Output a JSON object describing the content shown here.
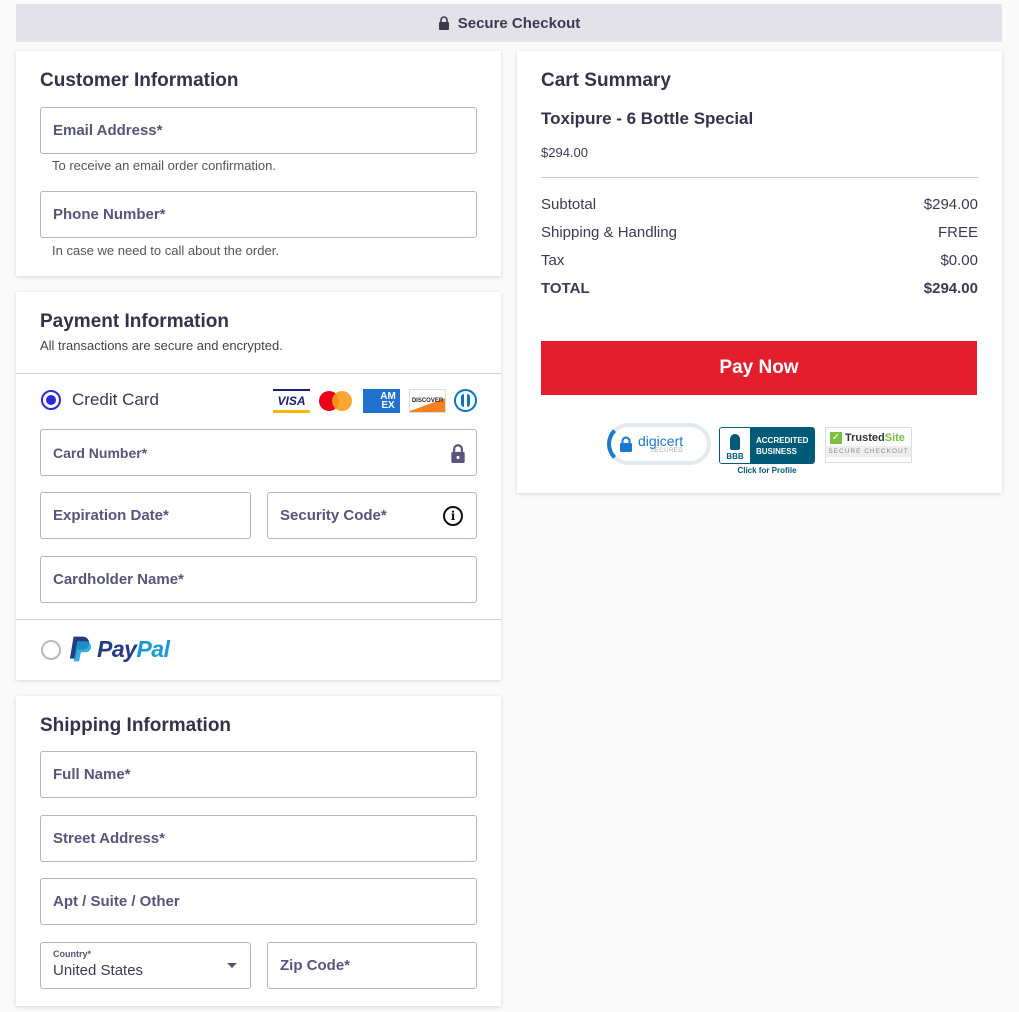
{
  "header": {
    "title": "Secure Checkout",
    "icon": "lock-icon"
  },
  "customer": {
    "title": "Customer Information",
    "email": {
      "label": "Email Address*",
      "value": "",
      "hint": "To receive an email order confirmation."
    },
    "phone": {
      "label": "Phone Number*",
      "value": "",
      "hint": "In case we need to call about the order."
    }
  },
  "payment": {
    "title": "Payment Information",
    "subtitle": "All transactions are secure and encrypted.",
    "credit_card": {
      "label": "Credit Card",
      "selected": true,
      "logos": [
        "visa",
        "mastercard",
        "amex",
        "discover",
        "diners-club"
      ],
      "visa_text": "VISA",
      "amex_text": "AM EX",
      "discover_text": "DISCOVER"
    },
    "card_number": {
      "label": "Card Number*",
      "icon": "lock-icon"
    },
    "expiration": {
      "label": "Expiration Date*"
    },
    "security_code": {
      "label": "Security Code*",
      "icon": "info-icon"
    },
    "cardholder": {
      "label": "Cardholder Name*"
    },
    "paypal": {
      "label": "PayPal",
      "pay": "Pay",
      "pal": "Pal",
      "selected": false
    }
  },
  "shipping": {
    "title": "Shipping Information",
    "full_name": {
      "label": "Full Name*"
    },
    "street": {
      "label": "Street Address*"
    },
    "apt": {
      "label": "Apt / Suite / Other"
    },
    "country": {
      "label": "Country*",
      "value": "United States"
    },
    "zip": {
      "label": "Zip Code*"
    }
  },
  "cart": {
    "title": "Cart Summary",
    "product_name": "Toxipure - 6 Bottle Special",
    "product_price": "$294.00",
    "rows": [
      {
        "label": "Subtotal",
        "value": "$294.00"
      },
      {
        "label": "Shipping & Handling",
        "value": "FREE"
      },
      {
        "label": "Tax",
        "value": "$0.00"
      },
      {
        "label": "TOTAL",
        "value": "$294.00"
      }
    ],
    "pay_button": "Pay Now",
    "badges": {
      "digicert": {
        "name": "digicert",
        "sub": "SECURED"
      },
      "bbb": {
        "line1": "ACCREDITED",
        "line2": "BUSINESS",
        "logo": "BBB",
        "link": "Click for Profile"
      },
      "trustedsite": {
        "trusted": "Trusted",
        "site": "Site",
        "sub": "SECURE CHECKOUT"
      }
    }
  },
  "colors": {
    "accent": "#2d2ad6",
    "pay_button": "#e31f2e",
    "text": "#3c3a52"
  }
}
